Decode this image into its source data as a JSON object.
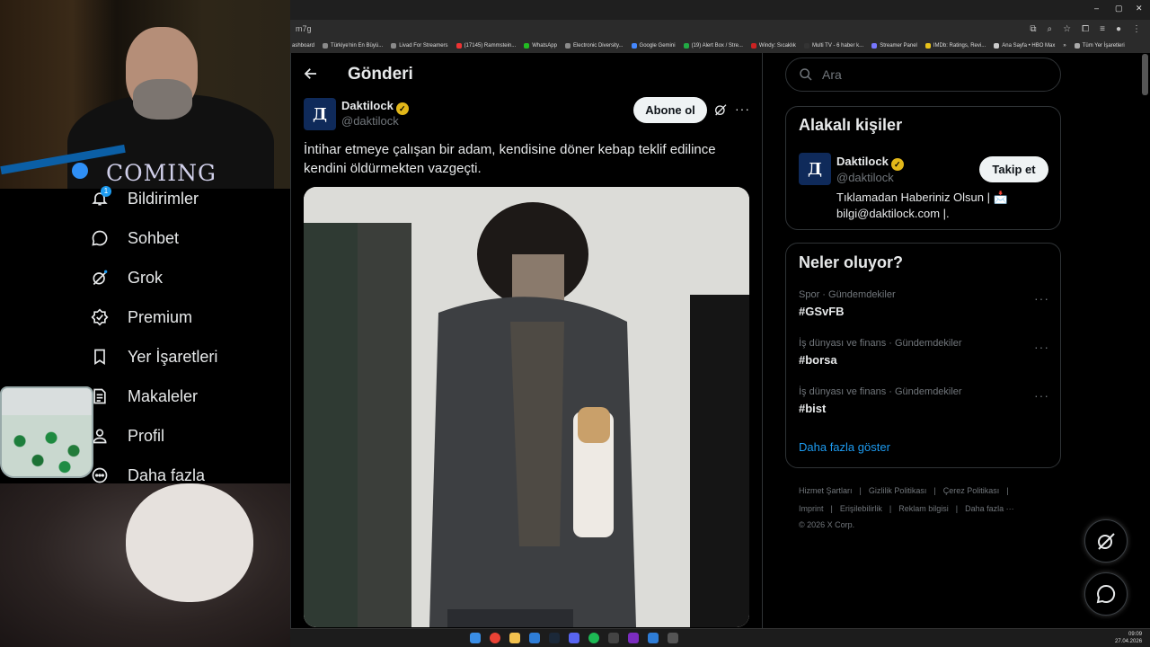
{
  "browser": {
    "url_fragment": "m7g",
    "bookmarks": [
      "ashboard",
      "Türkiye'nin En Büyü...",
      "Livad For Streamers",
      "(17145) Rammstein...",
      "WhatsApp",
      "Electronic Diversity...",
      "Google Gemini",
      "(19) Alert Box / Stre...",
      "Windy: Sıcaklık",
      "Multi TV - 6 haber k...",
      "Streamer Panel",
      "IMDb: Ratings, Revi...",
      "Ana Sayfa • HBO Max",
      "»",
      "Tüm Yer İşaretleri"
    ],
    "window_controls": [
      "–",
      "▢",
      "✕"
    ]
  },
  "overlay": {
    "coming_text": "COMING"
  },
  "sidebar": {
    "items": [
      {
        "label": "Bildirimler",
        "icon": "bell-icon"
      },
      {
        "label": "Sohbet",
        "icon": "chat-icon"
      },
      {
        "label": "Grok",
        "icon": "grok-icon"
      },
      {
        "label": "Premium",
        "icon": "verified-icon"
      },
      {
        "label": "Yer İşaretleri",
        "icon": "bookmark-icon"
      },
      {
        "label": "Makaleler",
        "icon": "article-icon"
      },
      {
        "label": "Profil",
        "icon": "person-icon"
      },
      {
        "label": "Daha fazla",
        "icon": "more-circle-icon"
      }
    ],
    "notification_badge": "1"
  },
  "post": {
    "header_title": "Gönderi",
    "author_name": "Daktilock",
    "author_handle": "@daktilock",
    "avatar_letter": "Д",
    "subscribe_label": "Abone ol",
    "text": "İntihar etmeye çalışan bir adam, kendisine döner kebap teklif edilince kendini öldürmekten vazgeçti."
  },
  "search": {
    "placeholder": "Ara"
  },
  "related": {
    "title": "Alakalı kişiler",
    "name": "Daktilock",
    "handle": "@daktilock",
    "follow_label": "Takip et",
    "bio_line1": "Tıklamadan Haberiniz Olsun | 📩",
    "bio_line2": "bilgi@daktilock.com |."
  },
  "trends": {
    "title": "Neler oluyor?",
    "items": [
      {
        "category": "Spor · Gündemdekiler",
        "tag": "#GSvFB"
      },
      {
        "category": "İş dünyası ve finans · Gündemdekiler",
        "tag": "#borsa"
      },
      {
        "category": "İş dünyası ve finans · Gündemdekiler",
        "tag": "#bist"
      }
    ],
    "show_more": "Daha fazla göster"
  },
  "footer": {
    "links_row1": [
      "Hizmet Şartları",
      "|",
      "Gizlilik Politikası",
      "|",
      "Çerez Politikası",
      "|"
    ],
    "links_row2": [
      "Imprint",
      "|",
      "Erişilebilirlik",
      "|",
      "Reklam bilgisi",
      "|",
      "Daha fazla ···"
    ],
    "copyright": "© 2026 X Corp."
  },
  "taskbar": {
    "time": "09:09",
    "date": "27.04.2026"
  },
  "colors": {
    "accent": "#1d9bf0",
    "verified": "#e2b719",
    "bg": "#000000",
    "border": "#2f3336"
  }
}
